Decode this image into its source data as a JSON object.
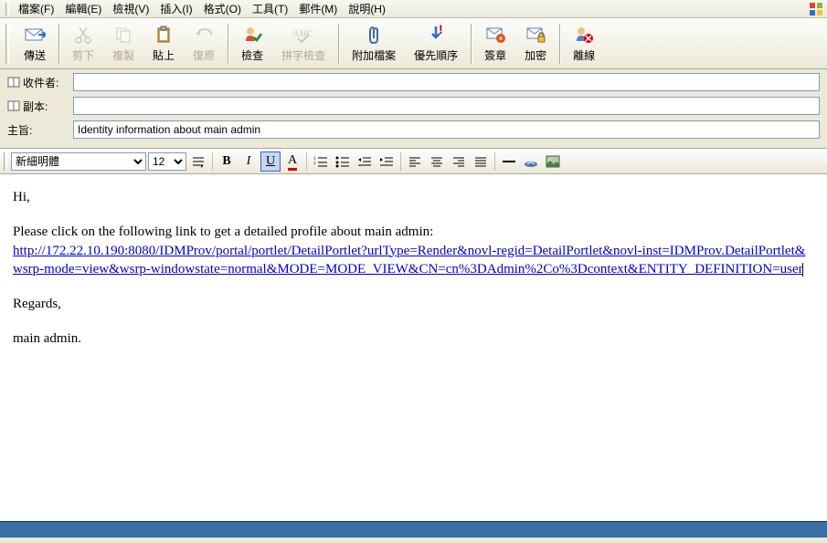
{
  "menu": {
    "file": "檔案(F)",
    "edit": "編輯(E)",
    "view": "檢視(V)",
    "insert": "插入(I)",
    "format": "格式(O)",
    "tools": "工具(T)",
    "mail": "郵件(M)",
    "help": "說明(H)"
  },
  "toolbar": {
    "send": "傳送",
    "cut": "剪下",
    "copy": "複製",
    "paste": "貼上",
    "undo": "復原",
    "check": "檢查",
    "spell": "拼字檢查",
    "attach": "附加檔案",
    "priority": "優先順序",
    "sign": "簽章",
    "encrypt": "加密",
    "offline": "離線"
  },
  "fields": {
    "to_label": "收件者:",
    "cc_label": "副本:",
    "subject_label": "主旨:",
    "to_value": "",
    "cc_value": "",
    "subject_value": "Identity information about main admin"
  },
  "format": {
    "font": "新細明體",
    "size": "12"
  },
  "body": {
    "greeting": "Hi,",
    "intro": "Please click on the following link to get a detailed profile about main admin:",
    "link": "http://172.22.10.190:8080/IDMProv/portal/portlet/DetailPortlet?urlType=Render&novl-regid=DetailPortlet&novl-inst=IDMProv.DetailPortlet&wsrp-mode=view&wsrp-windowstate=normal&MODE=MODE_VIEW&CN=cn%3DAdmin%2Co%3Dcontext&ENTITY_DEFINITION=user",
    "regards": "Regards,",
    "signature": "main admin."
  }
}
